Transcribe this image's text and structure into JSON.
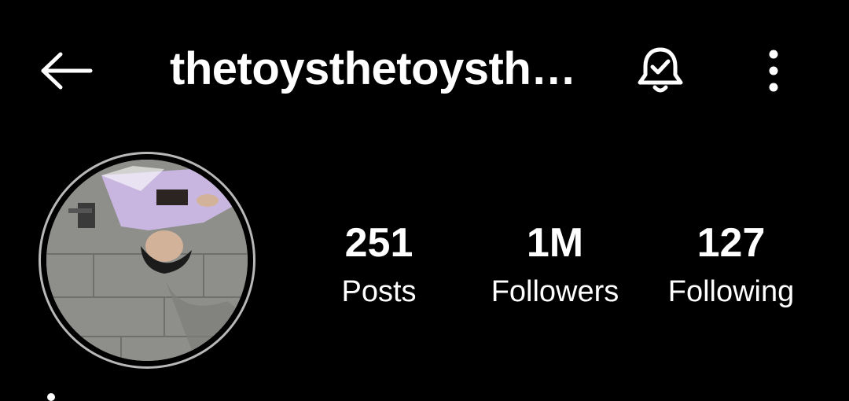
{
  "header": {
    "title": "thetoysthetoysth…",
    "back_icon": "arrow-left-icon",
    "notification_icon": "bell-check-icon",
    "more_icon": "more-vertical-icon"
  },
  "profile": {
    "avatar_icon": "profile-photo"
  },
  "stats": {
    "posts": {
      "value": "251",
      "label": "Posts"
    },
    "followers": {
      "value": "1M",
      "label": "Followers"
    },
    "following": {
      "value": "127",
      "label": "Following"
    }
  },
  "colors": {
    "background": "#000000",
    "text": "#ffffff",
    "avatar_ring": "#b8b8b8"
  }
}
